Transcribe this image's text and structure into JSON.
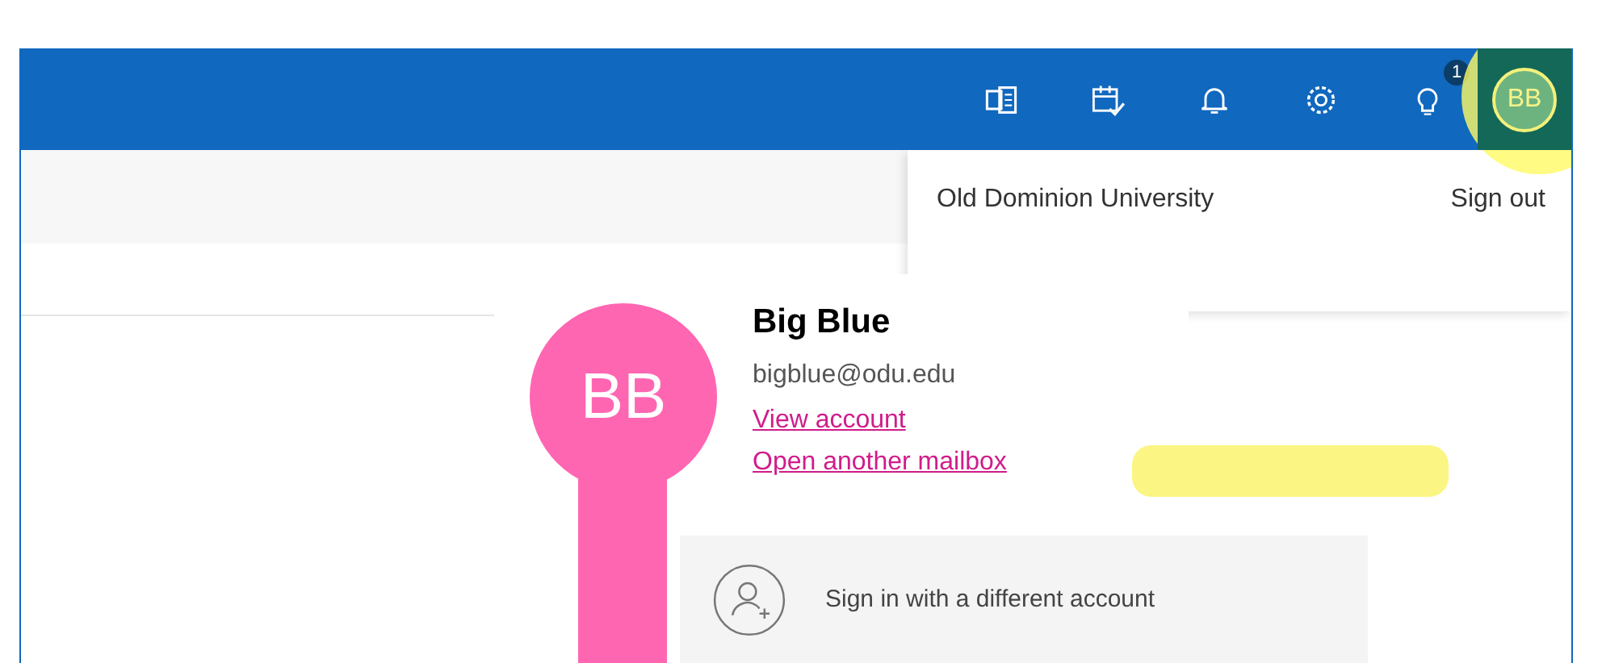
{
  "header": {
    "notification_badge": "1",
    "avatar_initials": "BB"
  },
  "account_panel": {
    "organization": "Old Dominion University",
    "sign_out": "Sign out"
  },
  "profile_card": {
    "initials": "BB",
    "name": "Big Blue",
    "email": "bigblue@odu.edu",
    "links": [
      "View account",
      "Open another mailbox"
    ]
  },
  "sign_in_option": "Sign in with a different account"
}
